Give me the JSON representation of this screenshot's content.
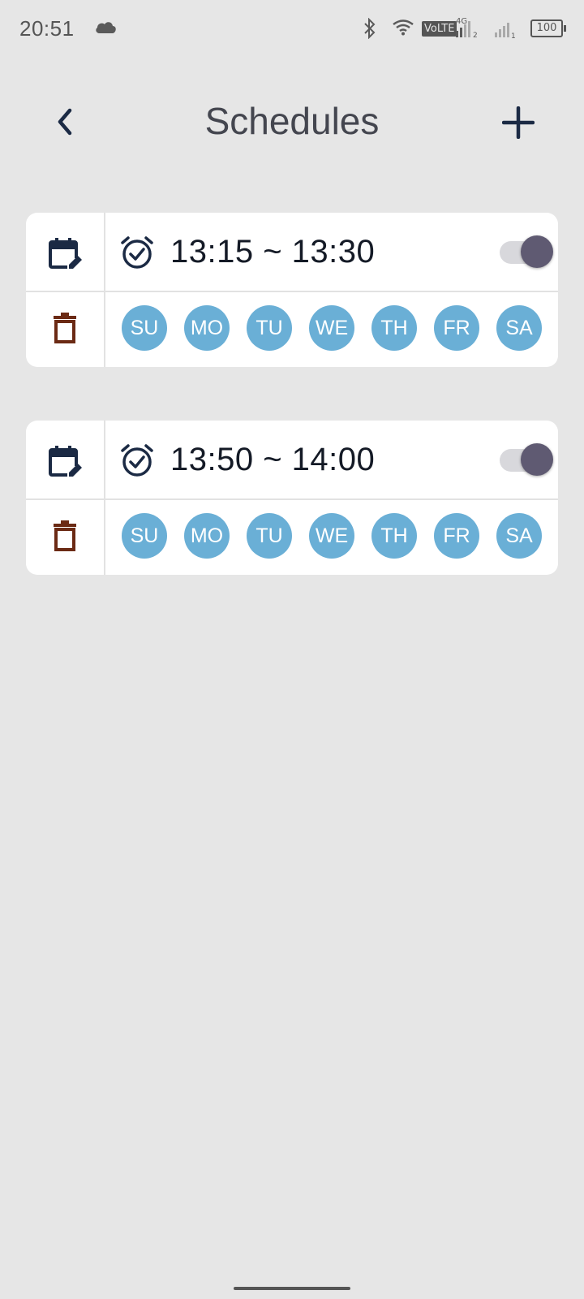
{
  "status_bar": {
    "time": "20:51",
    "icons": [
      "cloud-icon",
      "bluetooth-icon",
      "wifi-icon",
      "volte-badge",
      "signal-icon",
      "battery-icon"
    ],
    "volte": "VoLTE",
    "network": "4G",
    "battery": "100"
  },
  "header": {
    "title": "Schedules",
    "back_icon": "chevron-left-icon",
    "add_icon": "plus-icon"
  },
  "schedules": [
    {
      "time_range": "13:15 ~ 13:30",
      "enabled": true,
      "days": [
        "SU",
        "MO",
        "TU",
        "WE",
        "TH",
        "FR",
        "SA"
      ]
    },
    {
      "time_range": "13:50 ~ 14:00",
      "enabled": true,
      "days": [
        "SU",
        "MO",
        "TU",
        "WE",
        "TH",
        "FR",
        "SA"
      ]
    }
  ],
  "colors": {
    "background": "#e6e6e6",
    "card": "#ffffff",
    "accent_dark": "#1b2a44",
    "delete": "#6b2a14",
    "day_chip": "#6aafd6",
    "toggle_thumb": "#5f5a72"
  }
}
